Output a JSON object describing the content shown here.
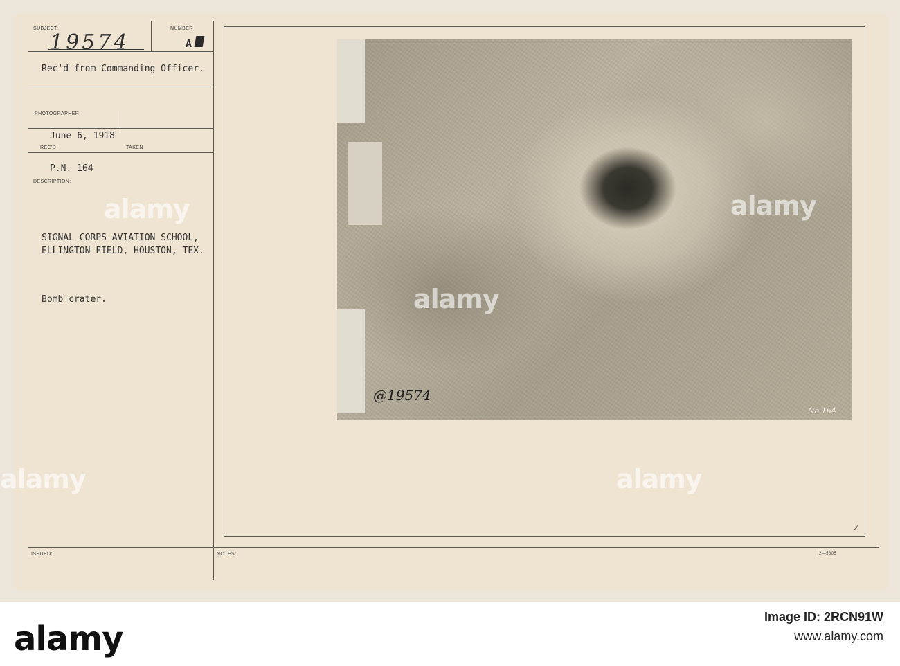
{
  "card": {
    "subject_label": "SUBJECT:",
    "subject_value": "19574",
    "number_label": "NUMBER",
    "number_value": "A",
    "received_from": "Rec'd from Commanding Officer.",
    "photographer_label": "PHOTOGRAPHER",
    "date": "June 6, 1918",
    "recd_label": "REC'D",
    "taken_label": "TAKEN",
    "pn": "P.N. 164",
    "description_label": "DESCRIPTION:",
    "description_line1": "SIGNAL CORPS AVIATION SCHOOL,",
    "description_line2": "ELLINGTON FIELD, HOUSTON, TEX.",
    "caption": "Bomb crater.",
    "issued_label": "ISSUED:",
    "notes_label": "NOTES:",
    "form_number": "2—5605",
    "check_mark": "✓"
  },
  "photo": {
    "neg_number": "@19574",
    "plate_number": "No 164"
  },
  "watermarks": [
    "alamy",
    "alamy",
    "alamy",
    "alamy",
    "alamy"
  ],
  "footer": {
    "brand": "alamy",
    "image_id_label": "Image ID: 2RCN91W",
    "site": "www.alamy.com"
  }
}
